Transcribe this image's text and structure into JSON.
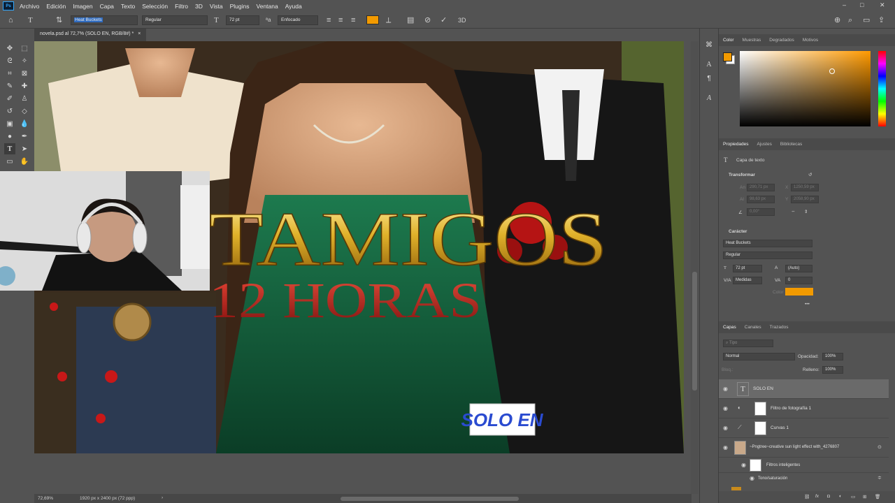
{
  "menubar": {
    "logo": "Ps",
    "items": [
      "Archivo",
      "Edición",
      "Imagen",
      "Capa",
      "Texto",
      "Selección",
      "Filtro",
      "3D",
      "Vista",
      "Plugins",
      "Ventana",
      "Ayuda"
    ],
    "window_controls": [
      "–",
      "□",
      "✕"
    ]
  },
  "options": {
    "font_family": "Heat Buckets",
    "font_style": "Regular",
    "font_size": "72 pt",
    "antialias": "Enfocado",
    "color": "#f29a00"
  },
  "document": {
    "tab": "novela.psd al 72,7% (SOLO EN, RGB/8#) *",
    "close": "×"
  },
  "canvas_text": {
    "title": "TAMIGOS",
    "subtitle": "12 HORAS",
    "badge": "SOLO EN"
  },
  "status": {
    "zoom": "72,69%",
    "size": "1920 px x 2400 px (72 ppp)",
    "chevron": "›"
  },
  "color_panel": {
    "tabs": [
      "Color",
      "Muestras",
      "Degradados",
      "Motivos"
    ],
    "foreground": "#f29a00",
    "background": "#ffffff",
    "hue_color": "#ff9a00"
  },
  "properties_panel": {
    "tabs": [
      "Propiedades",
      "Ajustes",
      "Bibliotecas"
    ],
    "layer_type": "Capa de texto",
    "transform_title": "Transformar",
    "transform": {
      "w_label": "An",
      "w": "290,71 px",
      "x_label": "X",
      "x": "1250,59 px",
      "h_label": "Al",
      "h": "98,63 px",
      "y_label": "Y",
      "y": "2058,90 px",
      "angle": "0,00°"
    },
    "character_title": "Carácter",
    "font_family": "Heat Buckets",
    "font_style": "Regular",
    "font_size": "72 pt",
    "leading": "(Auto)",
    "kerning": "Medidas",
    "tracking": "0",
    "color_label": "Color",
    "color": "#f29a00",
    "more": "•••"
  },
  "layers_panel": {
    "tabs": [
      "Capas",
      "Canales",
      "Trazados"
    ],
    "search_placeholder": "Tipo",
    "blend_mode": "Normal",
    "opacity_label": "Opacidad:",
    "opacity": "100%",
    "lock_label": "Bloq.:",
    "fill_label": "Relleno:",
    "fill": "100%",
    "layers": [
      {
        "name": "SOLO EN",
        "kind": "text",
        "selected": true
      },
      {
        "name": "Filtro de fotografía 1",
        "kind": "adjustment"
      },
      {
        "name": "Curvas 1",
        "kind": "adjustment"
      },
      {
        "name": "~Pngtree~creative sun light effect with_4276807",
        "kind": "smart"
      }
    ],
    "smart_filters": "Filtros inteligentes",
    "smart_filter_item": "Tono/saturación"
  }
}
